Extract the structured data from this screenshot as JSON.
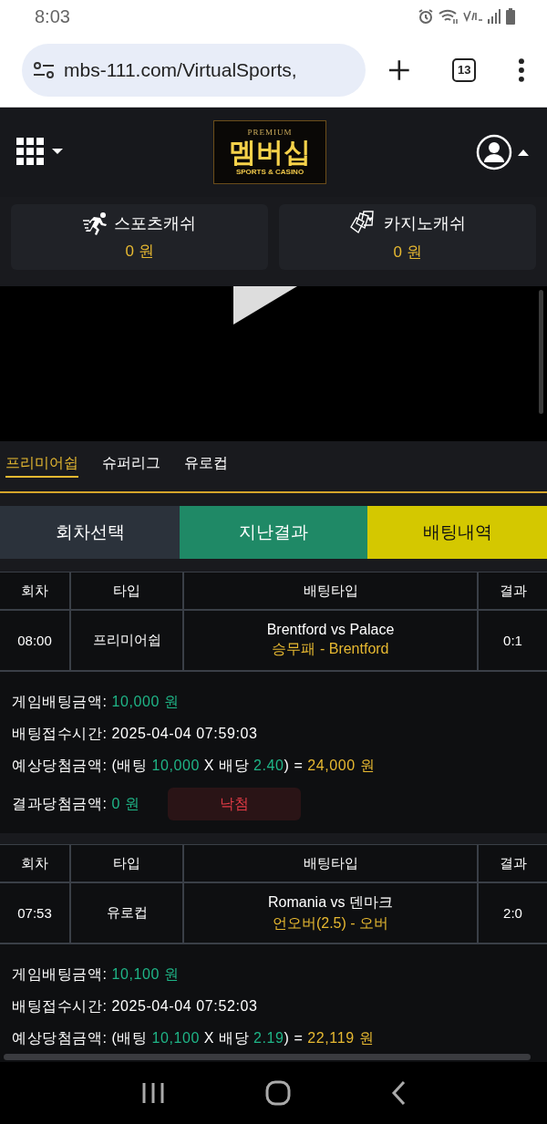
{
  "status_bar": {
    "time": "8:03"
  },
  "browser": {
    "url": "mbs-111.com/VirtualSports,",
    "tab_count": "13"
  },
  "header": {
    "logo": {
      "top": "PREMIUM",
      "main": "멤버십",
      "bottom": "SPORTS & CASINO"
    }
  },
  "wallets": [
    {
      "kind": "sports",
      "label": "스포츠캐쉬",
      "amount": "0 원"
    },
    {
      "kind": "casino",
      "label": "카지노캐쉬",
      "amount": "0 원"
    }
  ],
  "league_tabs": [
    {
      "label": "프리미어쉽",
      "selected": true
    },
    {
      "label": "슈퍼리그",
      "selected": false
    },
    {
      "label": "유로컵",
      "selected": false
    }
  ],
  "action_buttons": [
    {
      "label": "회차선택",
      "color": "#2b323b"
    },
    {
      "label": "지난결과",
      "color": "#1f8966"
    },
    {
      "label": "배팅내역",
      "color": "#d4c800"
    }
  ],
  "bets": [
    {
      "columns": [
        "회차",
        "타입",
        "배팅타입",
        "결과"
      ],
      "round": "08:00",
      "type": "프리미어쉽",
      "match": "Brentford vs Palace",
      "pick": "승무패 - Brentford",
      "result": "0:1",
      "lines": [
        {
          "label": "게임배팅금액:",
          "parts": [
            {
              "text": "10,000 원",
              "kind": "green",
              "tight": false
            }
          ]
        },
        {
          "label": "배팅접수시간:",
          "parts": [
            {
              "text": "2025-04-04 07:59:03",
              "kind": "plain",
              "tight": false
            }
          ]
        },
        {
          "label": "예상당첨금액:",
          "parts": [
            {
              "text": "(배팅",
              "kind": "plain",
              "tight": false
            },
            {
              "text": "10,000",
              "kind": "green",
              "tight": false
            },
            {
              "text": "X 배당",
              "kind": "plain",
              "tight": false
            },
            {
              "text": "2.40",
              "kind": "green",
              "tight": false
            },
            {
              "text": ") =",
              "kind": "plain",
              "tight": true
            },
            {
              "text": "24,000 원",
              "kind": "gold",
              "tight": false
            }
          ]
        },
        {
          "label": "결과당첨금액:",
          "parts": [
            {
              "text": "0 원",
              "kind": "green",
              "tight": false
            }
          ]
        }
      ],
      "outcome": {
        "label": "낙첨",
        "kind": "lost"
      }
    },
    {
      "columns": [
        "회차",
        "타입",
        "배팅타입",
        "결과"
      ],
      "round": "07:53",
      "type": "유로컵",
      "match": "Romania vs 덴마크",
      "pick": "언오버(2.5) - 오버",
      "result": "2:0",
      "lines": [
        {
          "label": "게임배팅금액:",
          "parts": [
            {
              "text": "10,100 원",
              "kind": "green",
              "tight": false
            }
          ]
        },
        {
          "label": "배팅접수시간:",
          "parts": [
            {
              "text": "2025-04-04 07:52:03",
              "kind": "plain",
              "tight": false
            }
          ]
        },
        {
          "label": "예상당첨금액:",
          "parts": [
            {
              "text": "(배팅",
              "kind": "plain",
              "tight": false
            },
            {
              "text": "10,100",
              "kind": "green",
              "tight": false
            },
            {
              "text": "X 배당",
              "kind": "plain",
              "tight": false
            },
            {
              "text": "2.19",
              "kind": "green",
              "tight": false
            },
            {
              "text": ") =",
              "kind": "plain",
              "tight": true
            },
            {
              "text": "22,119 원",
              "kind": "gold",
              "tight": false
            }
          ]
        }
      ]
    }
  ]
}
